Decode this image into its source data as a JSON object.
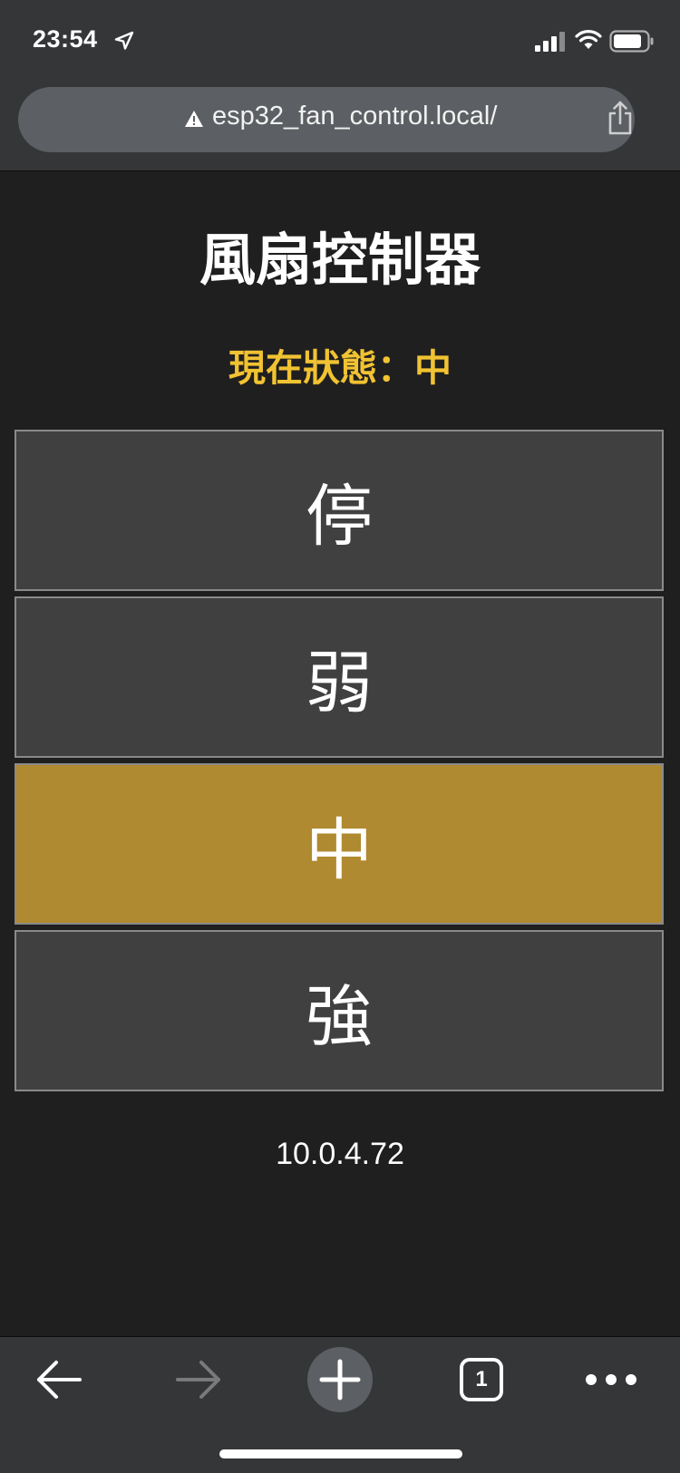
{
  "status_bar": {
    "time": "23:54"
  },
  "browser": {
    "url": "esp32_fan_control.local/",
    "open_tabs": "1"
  },
  "page": {
    "title": "風扇控制器",
    "status_text": "現在狀態：中",
    "buttons": [
      {
        "label": "停",
        "active": false
      },
      {
        "label": "弱",
        "active": false
      },
      {
        "label": "中",
        "active": true
      },
      {
        "label": "強",
        "active": false
      }
    ],
    "ip_address": "10.0.4.72"
  },
  "colors": {
    "background": "#1f1f1f",
    "button": "#404040",
    "button_active": "#b08a30",
    "status_text": "#f1c232"
  },
  "icons": {
    "status": [
      "location-arrow-icon",
      "cellular-signal-icon",
      "wifi-icon",
      "battery-icon"
    ],
    "url_bar": [
      "warning-icon",
      "share-icon"
    ],
    "toolbar": [
      "back-icon",
      "forward-icon",
      "new-tab-icon",
      "tabs-icon",
      "more-icon"
    ]
  }
}
